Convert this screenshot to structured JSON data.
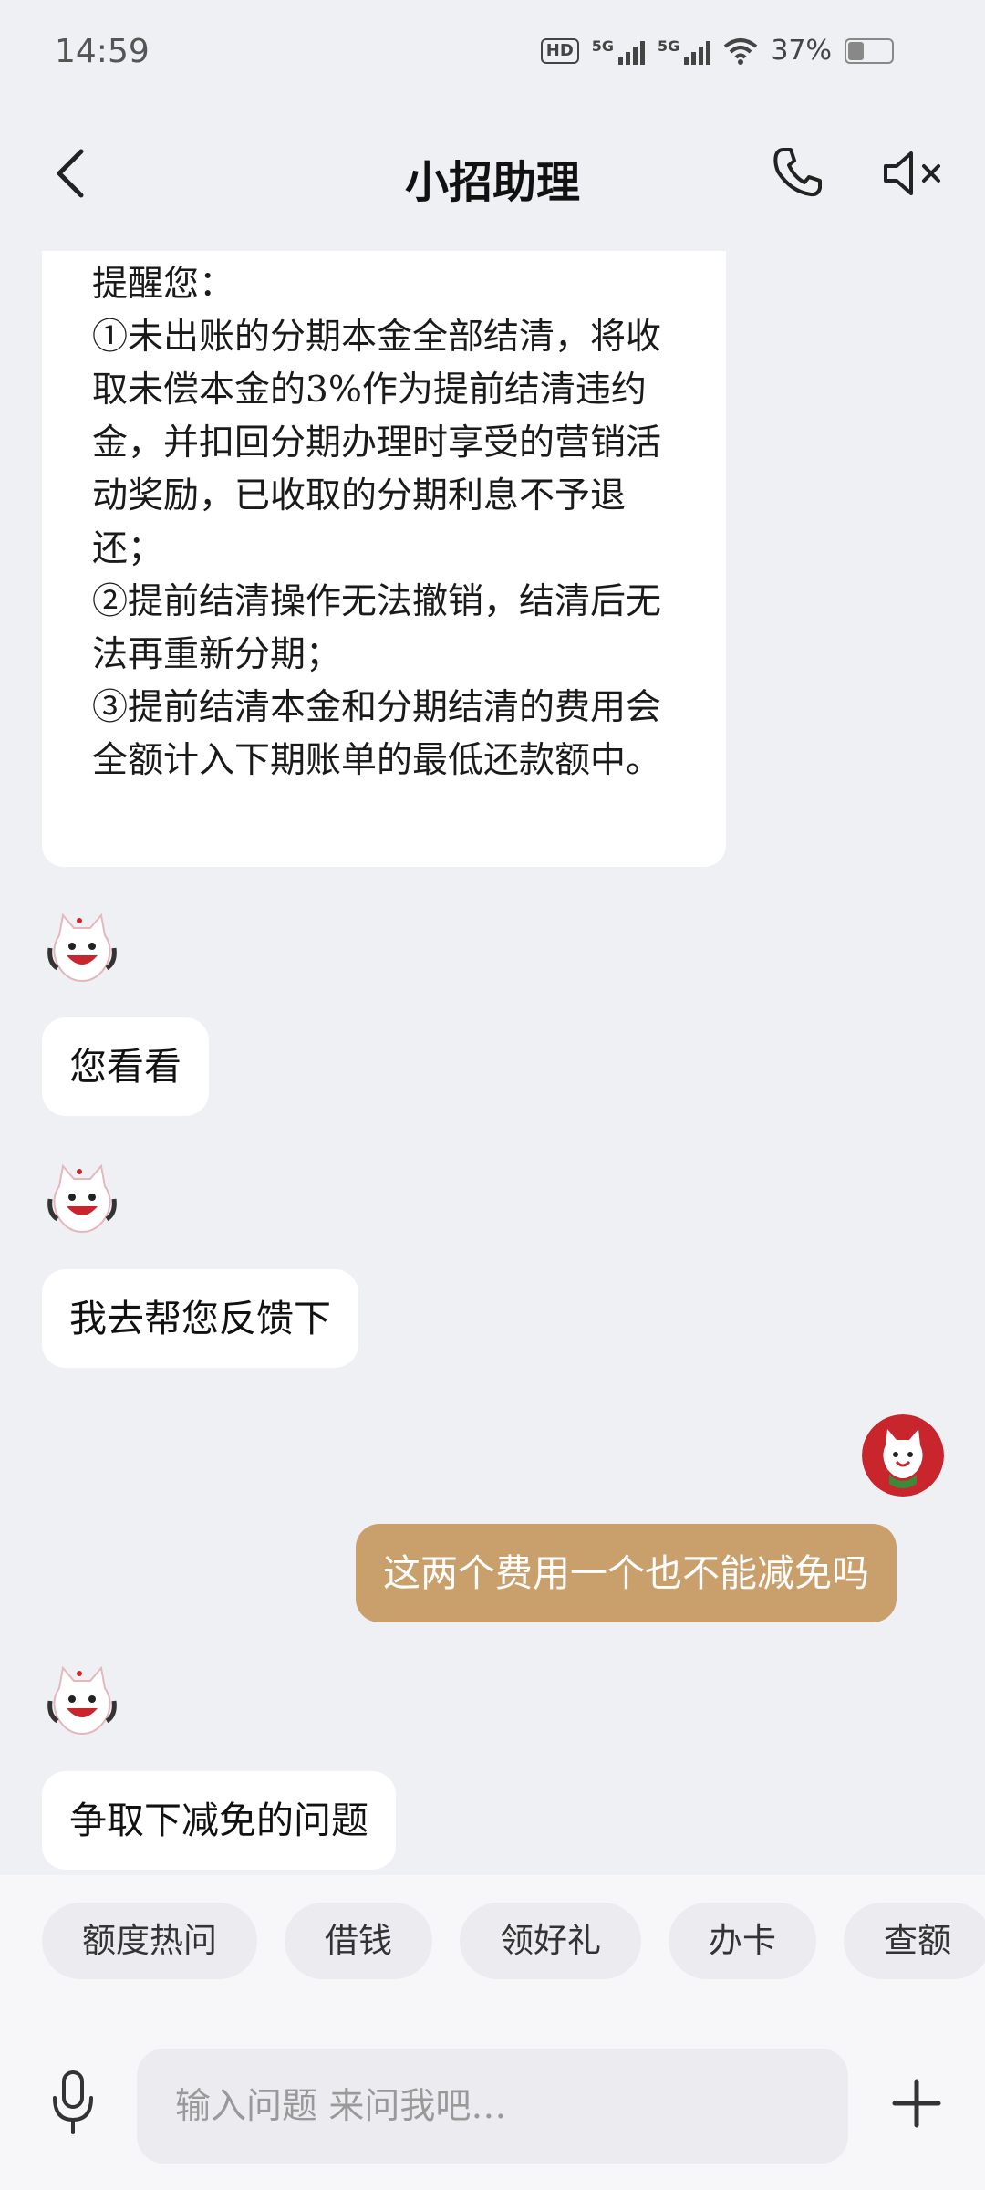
{
  "status_bar": {
    "time": "14:59",
    "network_badge": "HD",
    "signal1_label": "5G",
    "signal2_label": "5G",
    "battery_percent": "37%",
    "battery_level": 0.37
  },
  "header": {
    "title": "小招助理",
    "icons": [
      "back-arrow",
      "phone",
      "speaker-muted"
    ]
  },
  "messages": {
    "long_reply": [
      "提醒您：",
      "①未出账的分期本金全部结清，将收取未偿本金的3%作为提前结清违约金，并扣回分期办理时享受的营销活动奖励，已收取的分期利息不予退还；",
      "②提前结清操作无法撤销，结清后无法再重新分期；",
      "③提前结清本金和分期结清的费用会全额计入下期账单的最低还款额中。"
    ],
    "bot1": "您看看",
    "bot2": "我去帮您反馈下",
    "user1": "这两个费用一个也不能减免吗",
    "bot3": "争取下减免的问题"
  },
  "quick_replies": [
    "额度热问",
    "借钱",
    "领好礼",
    "办卡",
    "查额"
  ],
  "input": {
    "placeholder": "输入问题 来问我吧…",
    "value": ""
  },
  "colors": {
    "background": "#eff0f4",
    "user_bubble": "#c9a06c",
    "bot_bubble": "#ffffff",
    "avatar_red": "#c8262c"
  }
}
